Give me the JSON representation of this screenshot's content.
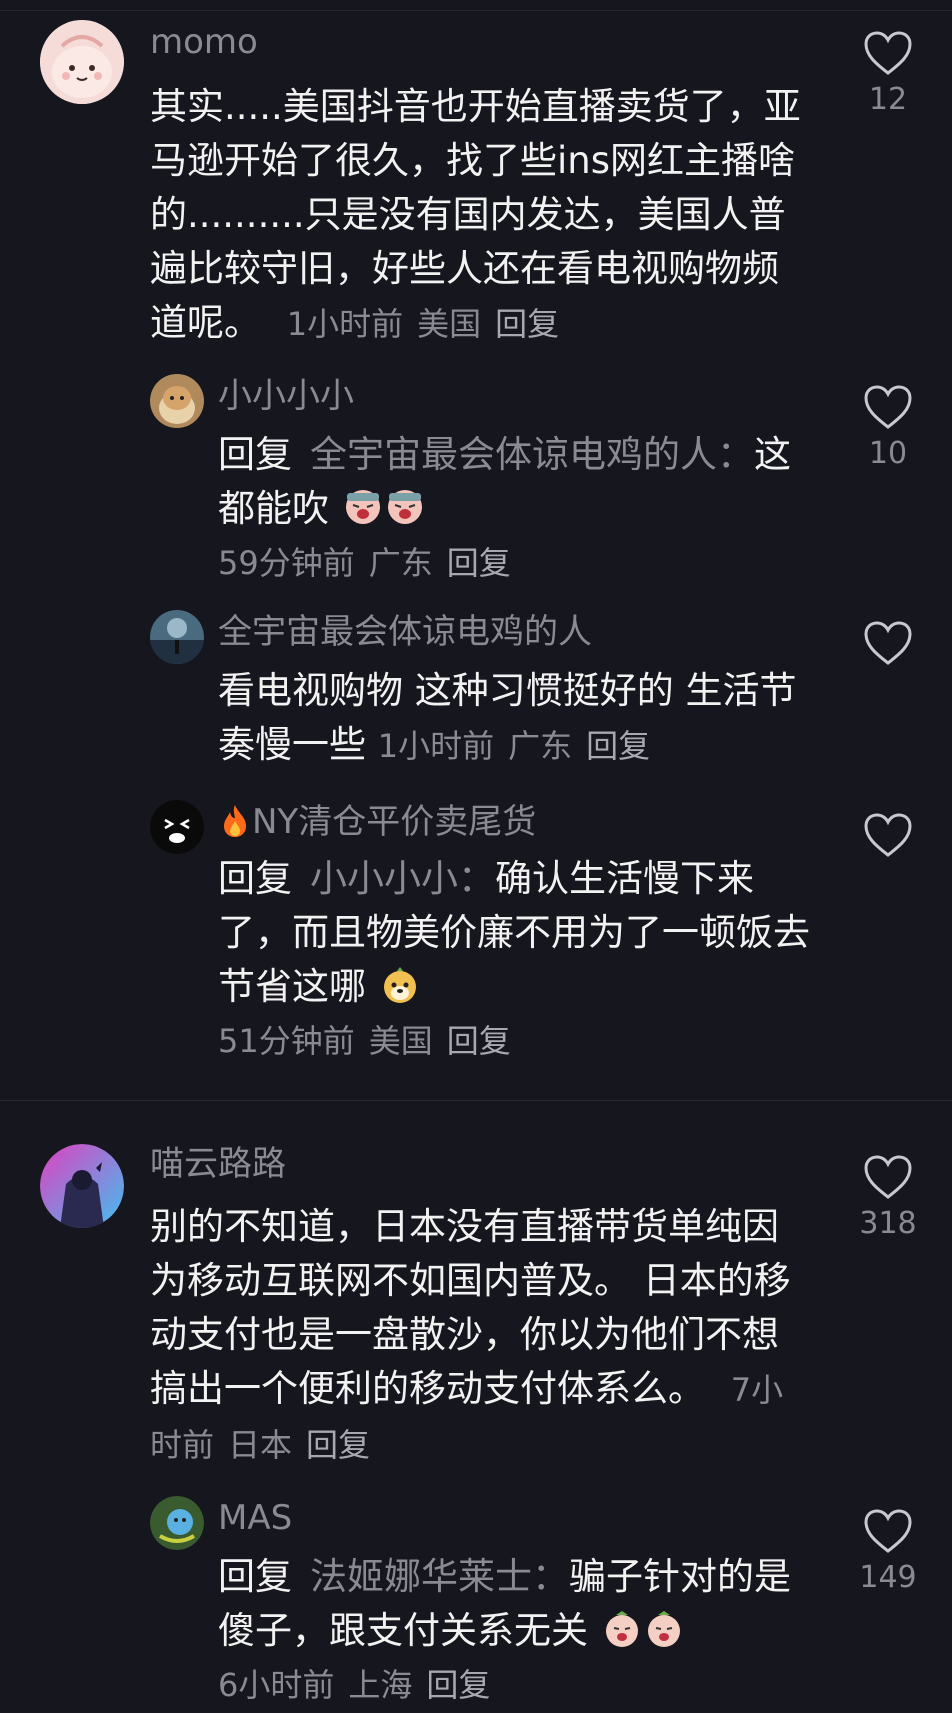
{
  "comments": [
    {
      "name": "momo",
      "text": "其实.....美国抖音也开始直播卖货了，亚马逊开始了很久，找了些ins网红主播啥的..........只是没有国内发达，美国人普遍比较守旧，好些人还在看电视购物频道呢。",
      "time": "1小时前",
      "location": "美国",
      "reply_label": "回复",
      "likes": "12"
    },
    {
      "name": "小小小小",
      "reply_prefix": "回复",
      "reply_target": "全宇宙最会体谅电鸡的人：",
      "text": "这都能吹",
      "emoji": "crying-face-emoji",
      "time": "59分钟前",
      "location": "广东",
      "reply_label": "回复",
      "likes": "10"
    },
    {
      "name": "全宇宙最会体谅电鸡的人",
      "text": "看电视购物 这种习惯挺好的 生活节奏慢一些",
      "time": "1小时前",
      "location": "广东",
      "reply_label": "回复",
      "likes": ""
    },
    {
      "name": "NY清仓平价卖尾货",
      "name_icon": "fire-icon",
      "reply_prefix": "回复",
      "reply_target": "小小小小：",
      "text": "确认生活慢下来了，而且物美价廉不用为了一顿饭去节省这哪",
      "emoji": "dog-face-emoji",
      "time": "51分钟前",
      "location": "美国",
      "reply_label": "回复",
      "likes": ""
    },
    {
      "name": "喵云路路",
      "text": "别的不知道，日本没有直播带货单纯因为移动互联网不如国内普及。 日本的移动支付也是一盘散沙，你以为他们不想搞出一个便利的移动支付体系么。",
      "time": "7小时前",
      "location": "日本",
      "reply_label": "回复",
      "likes": "318"
    },
    {
      "name": "MAS",
      "reply_prefix": "回复",
      "reply_target": "法姬娜华莱士：",
      "text": "骗子针对的是傻子，跟支付关系无关",
      "emoji": "hush-face-emoji",
      "time": "6小时前",
      "location": "上海",
      "reply_label": "回复",
      "likes": "149"
    }
  ],
  "colors": {
    "background": "#16161e",
    "text": "#f2f2f2",
    "secondary": "#8a8a92"
  }
}
